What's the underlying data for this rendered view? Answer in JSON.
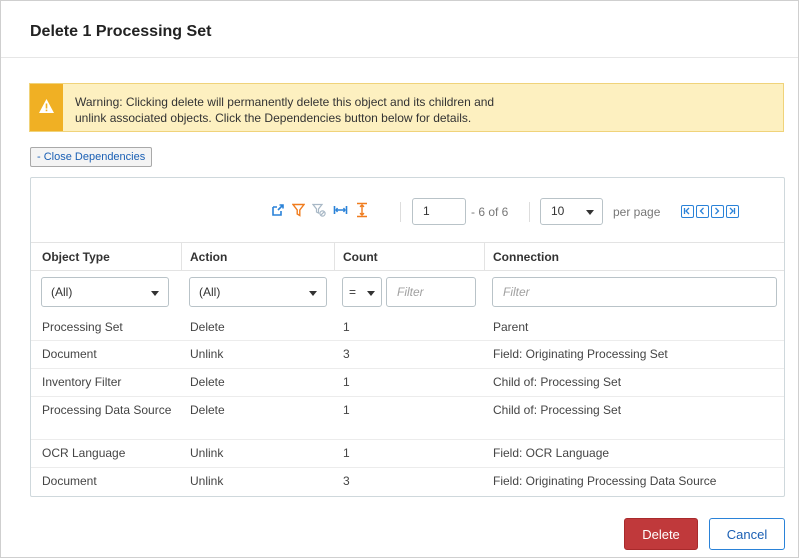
{
  "dialog": {
    "title": "Delete 1 Processing Set"
  },
  "warning": {
    "line1": "Warning: Clicking delete will permanently delete this object and its children and",
    "line2": "unlink associated objects. Click the Dependencies button below for details.",
    "color": "#fdf0c0",
    "icon_color": "#f0b024"
  },
  "close_dependencies_label": "- Close Dependencies",
  "toolbar": {
    "icons": [
      "export-icon",
      "filter-icon",
      "clear-filter-icon",
      "fit-columns-icon",
      "fit-rows-icon"
    ],
    "page_value": "1",
    "range_text": "- 6 of 6",
    "per_page_value": "10",
    "per_page_label": "per page",
    "pager_icons": [
      "first-page-icon",
      "previous-page-icon",
      "next-page-icon",
      "last-page-icon"
    ]
  },
  "table": {
    "columns": [
      "Object Type",
      "Action",
      "Count",
      "Connection"
    ],
    "filters": {
      "object_type": "(All)",
      "action": "(All)",
      "count_operator": "=",
      "count_placeholder": "Filter",
      "connection_placeholder": "Filter"
    },
    "rows": [
      {
        "object_type": "Processing Set",
        "action": "Delete",
        "count": "1",
        "connection": "Parent"
      },
      {
        "object_type": "Document",
        "action": "Unlink",
        "count": "3",
        "connection": "Field: Originating Processing Set"
      },
      {
        "object_type": "Inventory Filter",
        "action": "Delete",
        "count": "1",
        "connection": "Child of: Processing Set"
      },
      {
        "object_type": "Processing Data Source",
        "action": "Delete",
        "count": "1",
        "connection": "Child of: Processing Set"
      },
      {
        "object_type": "OCR Language",
        "action": "Unlink",
        "count": "1",
        "connection": "Field: OCR Language"
      },
      {
        "object_type": "Document",
        "action": "Unlink",
        "count": "3",
        "connection": "Field: Originating Processing Data Source"
      }
    ]
  },
  "buttons": {
    "delete": "Delete",
    "cancel": "Cancel",
    "delete_color": "#c0393b",
    "accent_color": "#2a82d8"
  }
}
